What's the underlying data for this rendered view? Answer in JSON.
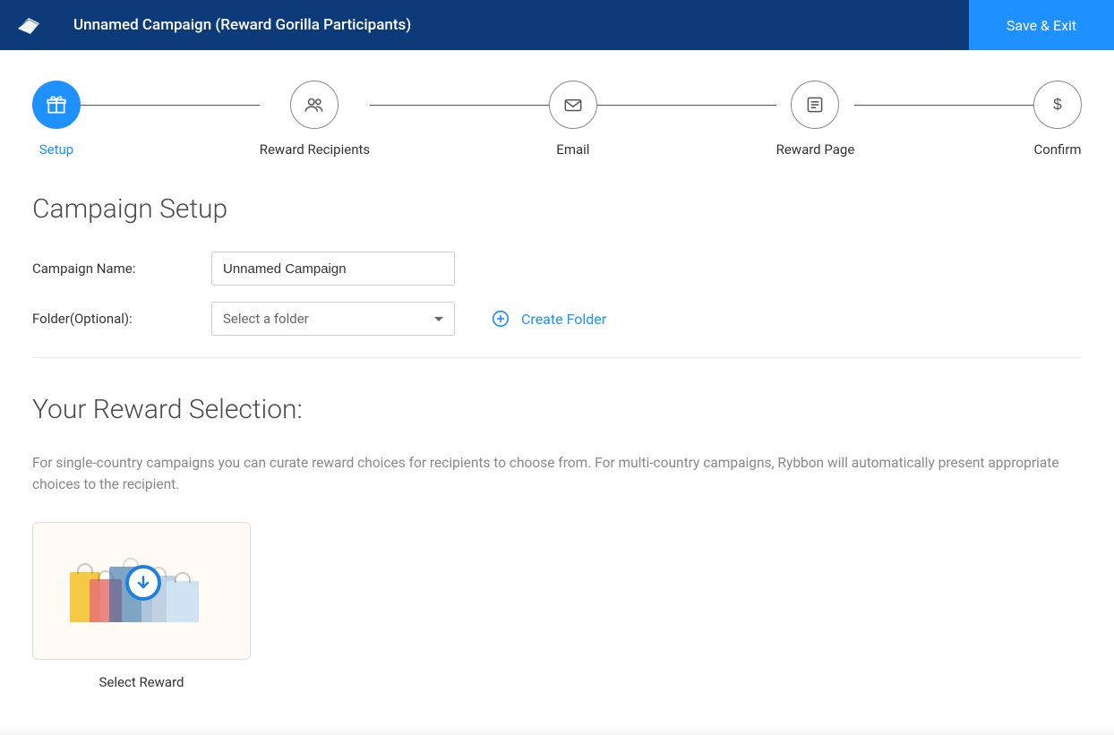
{
  "header": {
    "title": "Unnamed Campaign (Reward Gorilla Participants)",
    "save_label": "Save & Exit"
  },
  "wizard": {
    "steps": [
      {
        "label": "Setup",
        "active": true
      },
      {
        "label": "Reward Recipients",
        "active": false
      },
      {
        "label": "Email",
        "active": false
      },
      {
        "label": "Reward Page",
        "active": false
      },
      {
        "label": "Confirm",
        "active": false
      }
    ]
  },
  "setup": {
    "heading": "Campaign Setup",
    "campaign_name_label": "Campaign Name:",
    "campaign_name_value": "Unnamed Campaign",
    "folder_label": "Folder(Optional):",
    "folder_placeholder": "Select a folder",
    "create_folder_label": "Create Folder"
  },
  "reward": {
    "heading": "Your Reward Selection:",
    "description": "For single-country campaigns you can curate reward choices for recipients to choose from. For multi-country campaigns, Rybbon will automatically present appropriate choices to the recipient.",
    "select_label": "Select Reward"
  }
}
